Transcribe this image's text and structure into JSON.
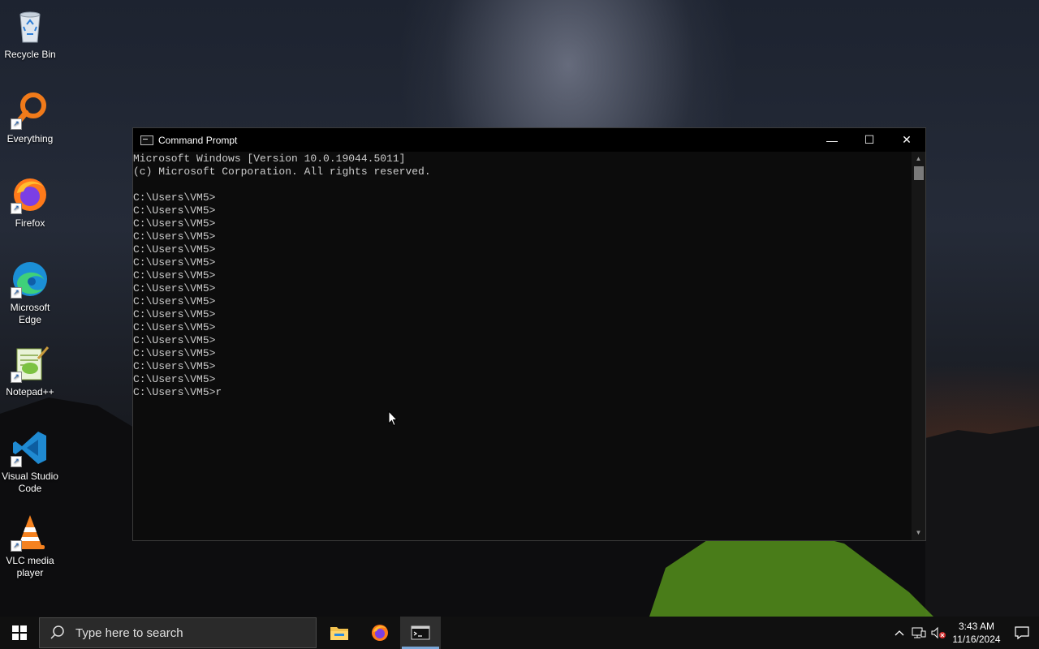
{
  "desktop": {
    "icons": [
      {
        "label": "Recycle Bin"
      },
      {
        "label": "Everything"
      },
      {
        "label": "Firefox"
      },
      {
        "label": "Microsoft Edge"
      },
      {
        "label": "Notepad++"
      },
      {
        "label": "Visual Studio Code"
      },
      {
        "label": "VLC media player"
      }
    ]
  },
  "cmd": {
    "title": "Command Prompt",
    "minimize": "—",
    "maximize": "☐",
    "close": "✕",
    "lines": [
      "Microsoft Windows [Version 10.0.19044.5011]",
      "(c) Microsoft Corporation. All rights reserved.",
      "",
      "C:\\Users\\VM5>",
      "C:\\Users\\VM5>",
      "C:\\Users\\VM5>",
      "C:\\Users\\VM5>",
      "C:\\Users\\VM5>",
      "C:\\Users\\VM5>",
      "C:\\Users\\VM5>",
      "C:\\Users\\VM5>",
      "C:\\Users\\VM5>",
      "C:\\Users\\VM5>",
      "C:\\Users\\VM5>",
      "C:\\Users\\VM5>",
      "C:\\Users\\VM5>",
      "C:\\Users\\VM5>",
      "C:\\Users\\VM5>",
      "C:\\Users\\VM5>r"
    ]
  },
  "taskbar": {
    "search_placeholder": "Type here to search",
    "time": "3:43 AM",
    "date": "11/16/2024"
  },
  "colors": {
    "terminal_bg": "#0c0c0c",
    "terminal_text": "#cccccc",
    "taskbar_bg": "#101010",
    "accent": "#7aa7d8"
  }
}
